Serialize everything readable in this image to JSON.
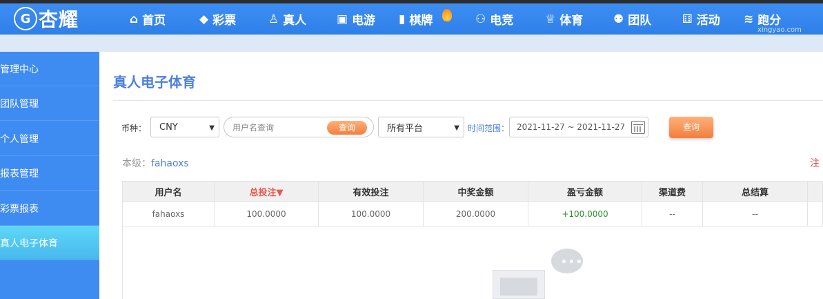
{
  "header": {
    "logo_badge": "G",
    "logo_text": "杏耀",
    "nav": [
      {
        "label": "首页",
        "icon": "home-icon",
        "glyph": "⌂"
      },
      {
        "label": "彩票",
        "icon": "ticket-icon",
        "glyph": "◆"
      },
      {
        "label": "真人",
        "icon": "dealer-icon",
        "glyph": "♙"
      },
      {
        "label": "电游",
        "icon": "slot-icon",
        "glyph": "▣"
      },
      {
        "label": "棋牌",
        "icon": "card-icon",
        "glyph": "▮"
      },
      {
        "label": "电竞",
        "icon": "gamepad-icon",
        "glyph": "⚇"
      },
      {
        "label": "体育",
        "icon": "trophy-icon",
        "glyph": "♕"
      },
      {
        "label": "团队",
        "icon": "team-icon",
        "glyph": "⚉"
      },
      {
        "label": "活动",
        "icon": "gift-icon",
        "glyph": "⚅"
      },
      {
        "label": "跑分",
        "icon": "run-icon",
        "glyph": "≋"
      }
    ],
    "watermark": "xingyao.com"
  },
  "sidebar": {
    "items": [
      {
        "label": "管理中心"
      },
      {
        "label": "团队管理"
      },
      {
        "label": "个人管理"
      },
      {
        "label": "报表管理"
      },
      {
        "label": "彩票报表"
      },
      {
        "label": "真人电子体育"
      }
    ],
    "active_index": 5
  },
  "main": {
    "title": "真人电子体育",
    "filters": {
      "currency_label": "币种：",
      "currency_value": "CNY",
      "username_placeholder": "用户名查询",
      "inline_search_label": "查询",
      "platform_value": "所有平台",
      "time_label": "时间范围：",
      "date_range": "2021-11-27 ~ 2021-11-27",
      "query_label": "查询"
    },
    "level_label": "本级：",
    "level_user": "fahaoxs",
    "note_label": "注",
    "table": {
      "headers": [
        "用户名",
        "总投注▼",
        "有效投注",
        "中奖金额",
        "盈亏金额",
        "渠道费",
        "总结算"
      ],
      "rows": [
        [
          "fahaoxs",
          "100.0000",
          "100.0000",
          "200.0000",
          "+100.0000",
          "--",
          "--"
        ]
      ]
    },
    "colors": {
      "accent_blue": "#3e8bf2",
      "sidebar_active": "#4fc4f2",
      "orange_button": "#f37e3d",
      "profit_green": "#2a8f2a",
      "sort_red": "#e65a4f"
    }
  }
}
